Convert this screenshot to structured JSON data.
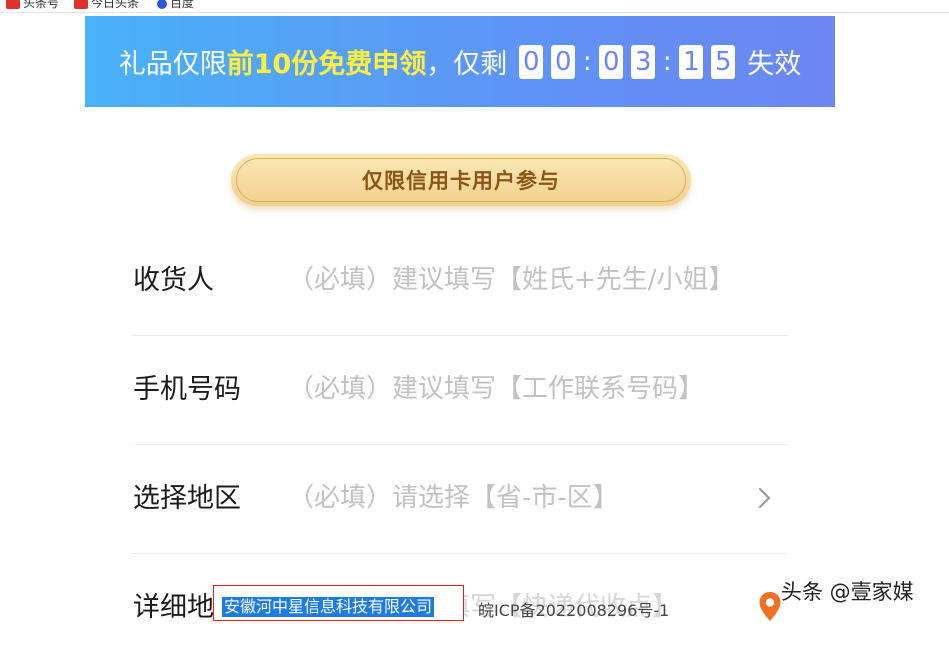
{
  "bookmarks": [
    {
      "label": "头条号",
      "icon": "toutiao-icon"
    },
    {
      "label": "今日头条",
      "icon": "toutiao-icon"
    },
    {
      "label": "百度",
      "icon": "baidu-icon"
    }
  ],
  "banner": {
    "prefix": "礼品仅限",
    "highlight": "前10份免费申领",
    "middle": "，仅剩",
    "digits": [
      "0",
      "0",
      "0",
      "3",
      "1",
      "5"
    ],
    "separator": ":",
    "suffix": "失效"
  },
  "badge": {
    "label": "仅限信用卡用户参与"
  },
  "form": {
    "rows": [
      {
        "label": "收货人",
        "placeholder": "（必填）建议填写【姓氏+先生/小姐】"
      },
      {
        "label": "手机号码",
        "placeholder": "（必填）建议填写【工作联系号码】"
      },
      {
        "label": "选择地区",
        "placeholder": "（必填）请选择【省-市-区】"
      },
      {
        "label": "详细地址",
        "placeholder": "（必填）建议填写【快递代收点】"
      }
    ]
  },
  "footer": {
    "company": "安徽河中星信息科技有限公司",
    "icp": "皖ICP备2022008296号-1"
  },
  "watermark": "头条 @壹家媒",
  "colors": {
    "banner_start": "#49b2f9",
    "banner_end": "#6c86f2",
    "highlight": "#ffee42",
    "badge_text": "#8a5616",
    "placeholder": "#c2c2c2"
  }
}
